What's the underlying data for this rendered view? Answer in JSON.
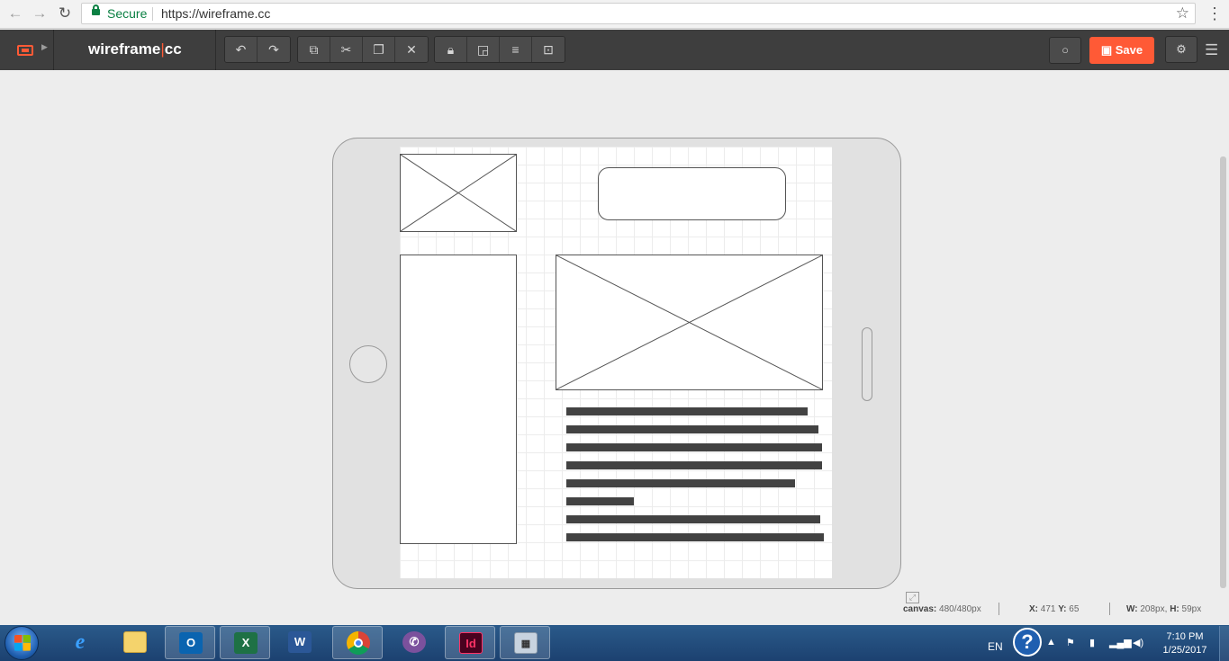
{
  "browser": {
    "back_icon": "arrow-left-icon",
    "forward_icon": "arrow-right-icon",
    "reload_icon": "reload-icon",
    "secure_label": "Secure",
    "url": "https://wireframe.cc",
    "bookmark_icon": "star-icon",
    "menu_icon": "kebab-menu-icon"
  },
  "app": {
    "logo_main": "wireframe",
    "logo_sep": "|",
    "logo_cc": "cc",
    "accent_color": "#ff5a36",
    "toolbar_color": "#3e3e3e",
    "history_buttons": [
      "undo-icon",
      "redo-icon"
    ],
    "edit_buttons": [
      "duplicate-icon",
      "cut-icon",
      "paste-icon",
      "delete-icon"
    ],
    "arrange_buttons": [
      "lock-icon",
      "layer-icon",
      "align-icon",
      "group-icon"
    ],
    "comment_icon": "comment-icon",
    "save_label": "Save",
    "save_icon": "floppy-icon",
    "settings_icon": "settings-icon",
    "menu_icon": "hamburger-icon"
  },
  "canvas": {
    "elements": [
      "image-placeholder",
      "button",
      "image-placeholder",
      "box",
      "text-block"
    ],
    "text_line_count": 8
  },
  "status": {
    "canvas_label": "canvas:",
    "canvas_value": "480/480px",
    "x_label": "X:",
    "x_value": "471",
    "y_label": "Y:",
    "y_value": "65",
    "w_label": "W:",
    "w_value": "208px,",
    "h_label": "H:",
    "h_value": "59px"
  },
  "taskbar": {
    "apps": [
      "internet-explorer-icon",
      "file-explorer-icon",
      "outlook-icon",
      "excel-icon",
      "word-icon",
      "chrome-icon",
      "viber-icon",
      "indesign-icon",
      "calculator-icon"
    ],
    "language": "EN",
    "time": "7:10 PM",
    "date": "1/25/2017"
  }
}
